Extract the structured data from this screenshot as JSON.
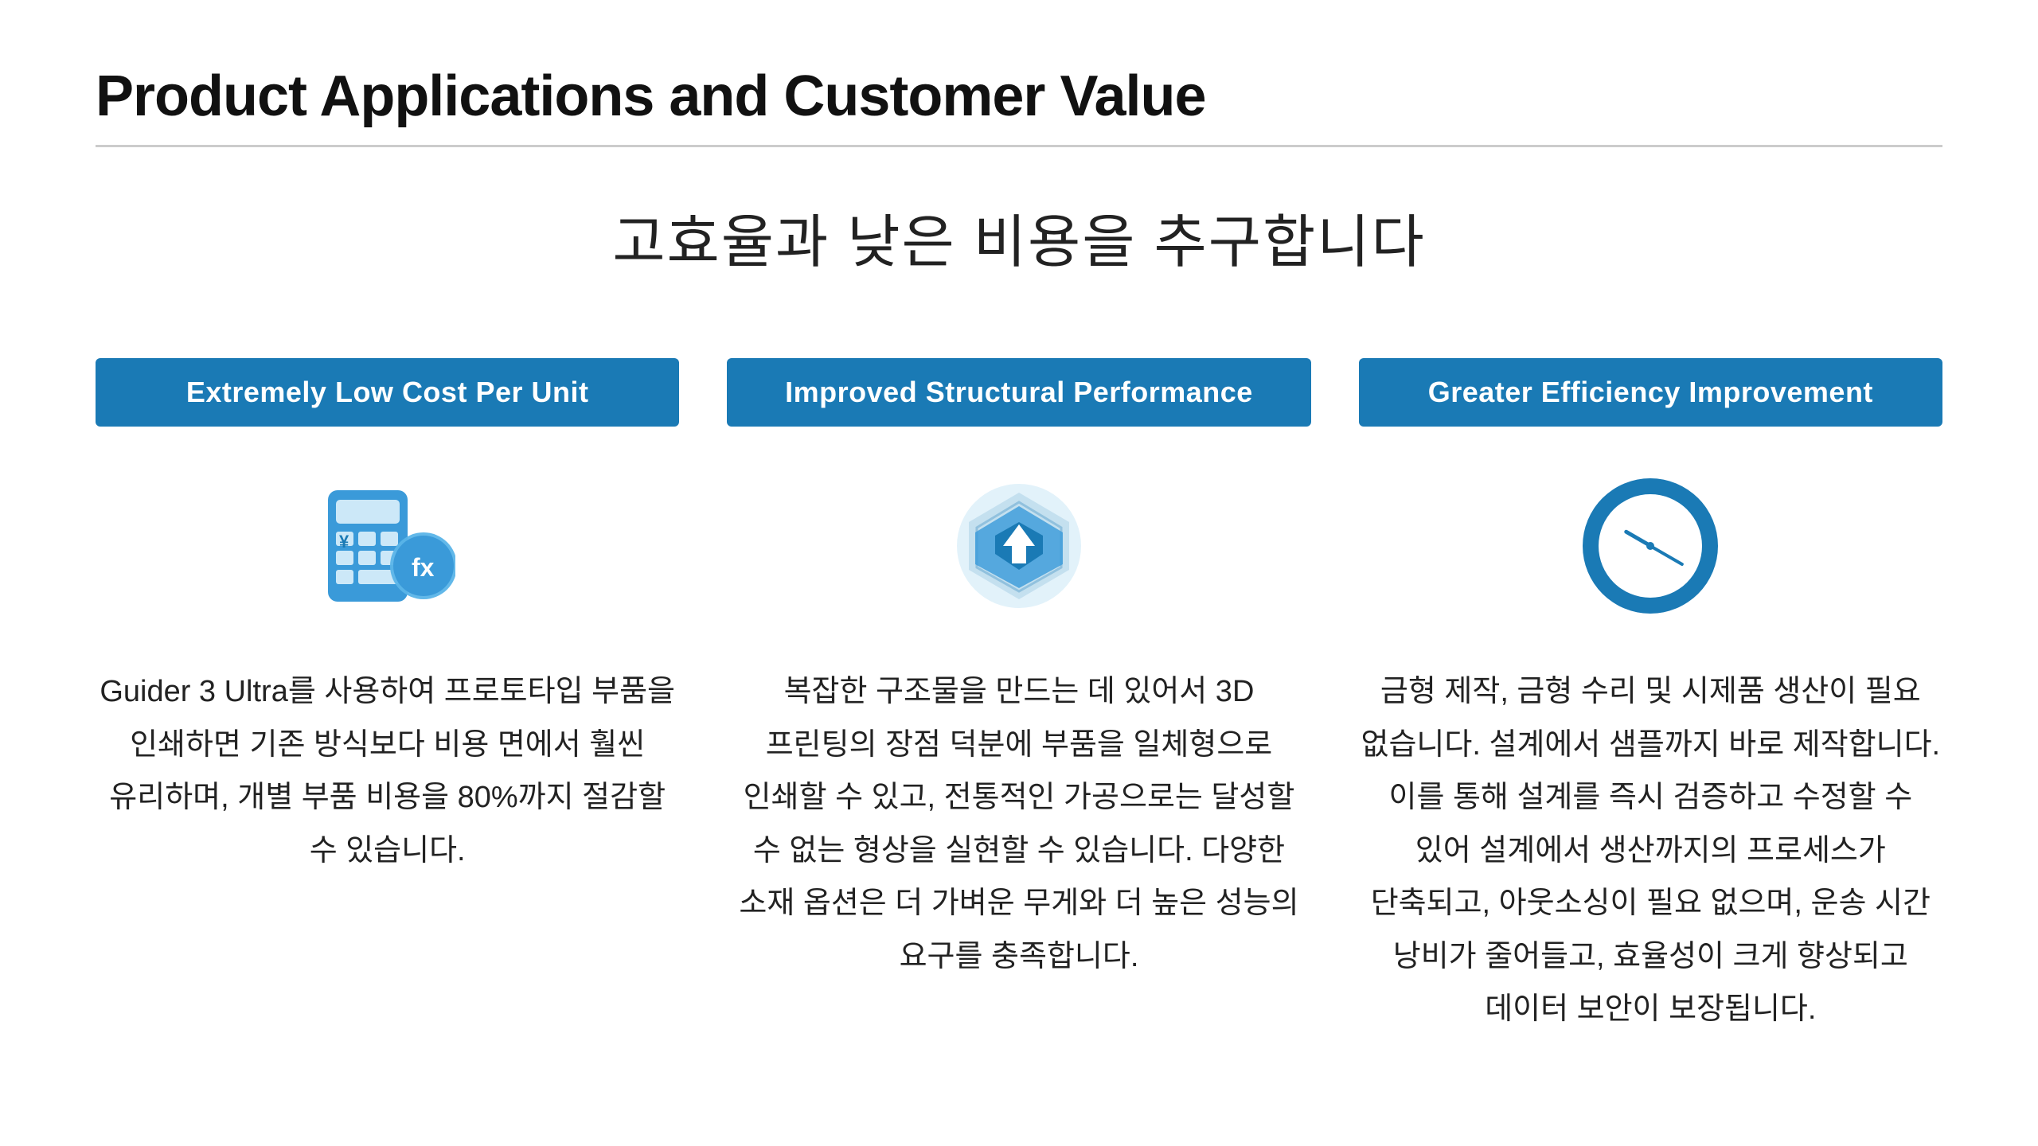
{
  "page": {
    "title": "Product Applications and Customer Value",
    "subtitle": "고효율과 낮은 비용을 추구합니다"
  },
  "columns": [
    {
      "badge": "Extremely Low Cost Per Unit",
      "icon_type": "calculator",
      "text": "Guider 3 Ultra를 사용하여 프로토타입 부품을 인쇄하면 기존 방식보다 비용 면에서 훨씬 유리하며, 개별 부품 비용을 80%까지 절감할 수 있습니다."
    },
    {
      "badge": "Improved Structural Performance",
      "icon_type": "structural",
      "text": "복잡한 구조물을 만드는 데 있어서 3D 프린팅의 장점 덕분에 부품을 일체형으로 인쇄할 수 있고, 전통적인 가공으로는 달성할 수 없는 형상을 실현할 수 있습니다. 다양한 소재 옵션은 더 가벼운 무게와 더 높은 성능의 요구를 충족합니다."
    },
    {
      "badge": "Greater Efficiency Improvement",
      "icon_type": "clock",
      "text": "금형 제작, 금형 수리 및 시제품 생산이 필요 없습니다. 설계에서 샘플까지 바로 제작합니다. 이를 통해 설계를 즉시 검증하고 수정할 수 있어 설계에서 생산까지의 프로세스가 단축되고, 아웃소싱이 필요 없으며, 운송 시간 낭비가 줄어들고, 효율성이 크게 향상되고 데이터 보안이 보장됩니다."
    }
  ],
  "colors": {
    "badge_bg": "#1a7ab5",
    "badge_text": "#ffffff",
    "title": "#111111",
    "divider": "#cccccc",
    "body_text": "#222222"
  }
}
